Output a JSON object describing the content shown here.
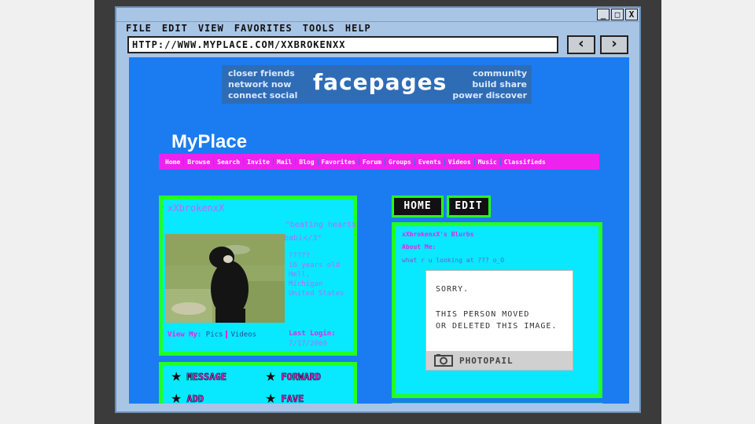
{
  "window": {
    "min": "_",
    "max": "□",
    "close": "X"
  },
  "menu": [
    "FILE",
    "EDIT",
    "VIEW",
    "FAVORITES",
    "TOOLS",
    "HELP"
  ],
  "address": {
    "url": "HTTP://WWW.MYPLACE.COM/XXBROKENXX"
  },
  "nav": {
    "back": "‹",
    "forward": "›"
  },
  "banner": {
    "left": [
      "closer friends",
      "network now",
      "connect social"
    ],
    "title": "facepages",
    "right": [
      "community",
      "build share",
      "power discover"
    ]
  },
  "site": {
    "title": "MyPlace"
  },
  "navbar": [
    "Home",
    "Browse",
    "Search",
    "Invite",
    "Mail",
    "Blog",
    "Favorites",
    "Forum",
    "Groups",
    "Events",
    "Videos",
    "Music",
    "Classifieds"
  ],
  "profile": {
    "name": "xXbrokenxX",
    "quote_line1": "\"beating hearts",
    "quote_line2": "babi</3\"",
    "info": [
      "?????",
      "16 years old",
      "Hell,",
      "Michigan",
      "United States"
    ],
    "view_label": "View My:",
    "pics": "Pics",
    "videos": "Videos",
    "last_login_label": "Last Login:",
    "last_login_value": "7/17/2009"
  },
  "actions": {
    "message": "MESSAGE",
    "forward": "FORWARD",
    "add": "ADD",
    "fave": "FAVE"
  },
  "tabs": {
    "home": "HOME",
    "edit": "EDIT"
  },
  "blurbs": {
    "title": "xXbrokenxX's Blurbs",
    "about_label": "About Me:",
    "about_text": "what r u looking at ??? o_O"
  },
  "placeholder": {
    "sorry": "SORRY.",
    "line1": "THIS PERSON MOVED",
    "line2": "OR DELETED THIS IMAGE.",
    "brand": "PHOTOPAIL"
  },
  "colors": {
    "page_bg": "#1a7cf0",
    "box_bg": "#08e8ff",
    "border_green": "#22ff22",
    "magenta": "#ee22ee"
  }
}
